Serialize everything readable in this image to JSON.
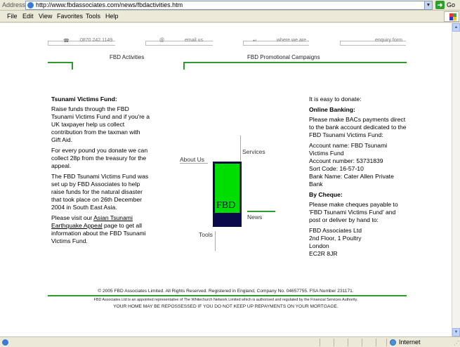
{
  "browser": {
    "address_label": "Address",
    "url": "http://www.fbdassociates.com/news/fbdactivities.htm",
    "go_label": "Go",
    "menu": [
      "File",
      "Edit",
      "View",
      "Favorites",
      "Tools",
      "Help"
    ],
    "status_zone": "Internet"
  },
  "top_links": {
    "phone": "0870 242 1149",
    "email": "email us",
    "where": "where we are",
    "enquiry": "enquiry form"
  },
  "tabs": {
    "activities": "FBD Activities",
    "promotional": "FBD Promotional Campaigns"
  },
  "left_column": {
    "heading": "Tsunami Victims Fund:",
    "para1": "Raise funds through the FBD Tsunami Victims Fund and if you're a UK taxpayer help us collect contribution from the taxman with Gift Aid.",
    "para2": "For every pound you donate we can collect 28p from the treasury for the appeal.",
    "para3": "The FBD Tsunami Victims Fund was set up by FBD Associates to help raise funds for the natural disaster that took place on 26th December 2004 in South East Asia.",
    "para4_before": "Please visit our ",
    "para4_link": "Asian Tsunami Earthquake Appeal",
    "para4_after": " page to get all information about the FBD Tsunami Victims Fund."
  },
  "nav": {
    "about": "About Us",
    "services": "Services",
    "news": "News",
    "tools": "Tools",
    "logo_text": "FBD"
  },
  "right_column": {
    "intro": "It is easy to donate:",
    "online_heading": "Online Banking:",
    "online_text": "Please make BACs payments direct to the bank account dedicated to the FBD Tsunami Victims Fund:",
    "account_name": "Account name: FBD Tsunami Victims Fund",
    "account_number": "Account number: 53731839",
    "sort_code": "Sort Code: 16-57-10",
    "bank_name": "Bank Name: Cater Allen Private Bank",
    "cheque_heading": "By Cheque:",
    "cheque_text": "Please make cheques payable to 'FBD Tsunami Victims Fund' and post or deliver by hand to:",
    "address1": "FBD Associates Ltd",
    "address2": "2nd Floor, 1 Poultry",
    "address3": "London",
    "address4": "EC2R 8JR"
  },
  "footer": {
    "copyright": "© 2005  FBD Associates Limited.  All Rights Reserved. Registered in England, Company No. 04657755.  FSA Number 231171.",
    "regulation": "FBD Associates Ltd is an appointed representative of The Whitechurch Network Limited which is authorised and regulated by the Financial Services Authority.",
    "warning": "YOUR HOME MAY BE REPOSSESSED IF YOU DO NOT KEEP UP REPAYMENTS ON YOUR MORTGAGE."
  },
  "colors": {
    "accent_green": "#2c9b2c",
    "logo_green": "#00dd00",
    "logo_navy": "#0a0a4a"
  }
}
